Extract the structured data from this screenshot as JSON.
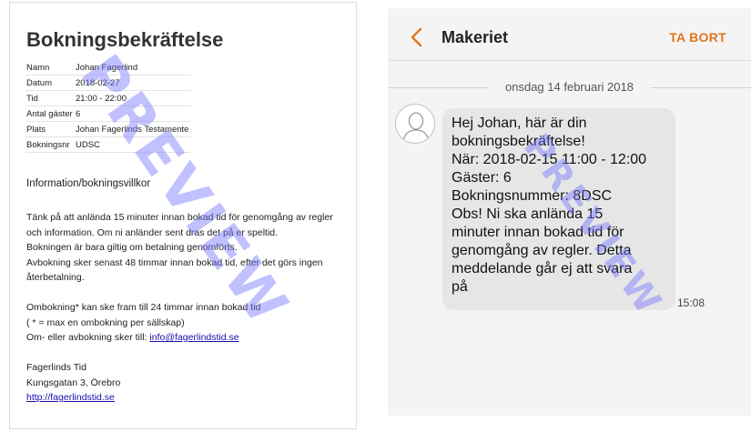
{
  "email": {
    "title": "Bokningsbekräftelse",
    "booking_rows": [
      {
        "label": "Namn",
        "value": "Johan Fagerlind"
      },
      {
        "label": "Datum",
        "value": "2018-02-27"
      },
      {
        "label": "Tid",
        "value": "21:00 - 22:00"
      },
      {
        "label": "Antal gäster",
        "value": "6"
      },
      {
        "label": "Plats",
        "value": "Johan Fagerlinds Testamente"
      },
      {
        "label": "Bokningsnr",
        "value": "UDSC"
      }
    ],
    "info_heading": "Information/bokningsvillkor",
    "paragraph1": [
      "Tänk på att anlända 15 minuter innan bokad tid för genomgång av regler",
      "och information. Om ni anländer sent dras det på er speltid.",
      "Bokningen är bara giltig om betalning genomförts.",
      "Avbokning sker senast 48 timmar innan bokad tid, efter det görs ingen",
      "återbetalning."
    ],
    "paragraph2": [
      "Ombokning* kan ske fram till 24 timmar innan bokad tid",
      "( * = max en ombokning per sällskap)"
    ],
    "cancel_prefix": "Om- eller avbokning sker till: ",
    "cancel_email": "info@fagerlindstid.se",
    "company_name": "Fagerlinds Tid",
    "address": "Kungsgatan 3, Örebro",
    "website": "http://fagerlindstid.se"
  },
  "sms": {
    "contact_name": "Makeriet",
    "delete_label": "TA BORT",
    "date_separator": "onsdag 14 februari 2018",
    "message_lines": [
      "Hej Johan, här är din",
      "bokningsbekräftelse!",
      "När: 2018-02-15 11:00 - 12:00",
      "Gäster: 6",
      "Bokningsnummer: 8DSC",
      "Obs! Ni ska anlända 15",
      "minuter innan bokad tid för",
      "genomgång av regler. Detta",
      "meddelande går ej att svara",
      "på"
    ],
    "time": "15:08"
  },
  "watermark": "PREVIEW",
  "colors": {
    "accent_orange": "#e0761f",
    "link_blue": "#1a0dab",
    "watermark": "#7676ff"
  },
  "icons": {
    "back": "chevron-left-icon",
    "avatar": "person-avatar-icon"
  }
}
